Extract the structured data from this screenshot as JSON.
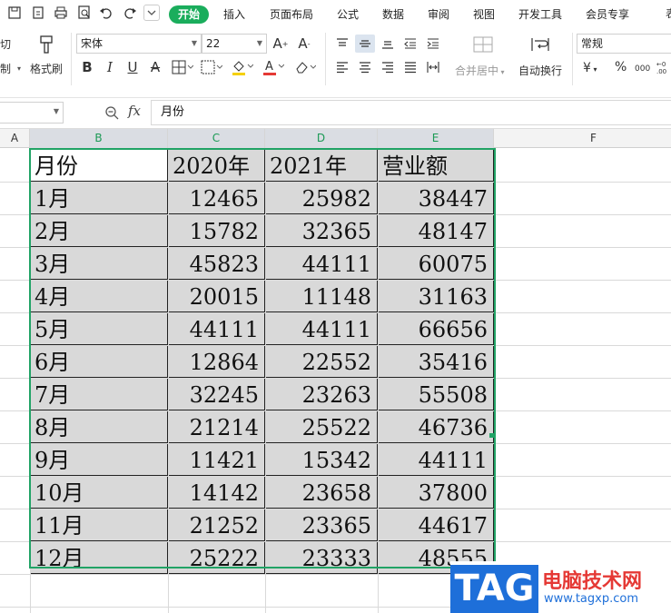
{
  "colors": {
    "accent": "#1aad5c",
    "selection_border": "#21a366",
    "cell_fill": "#d9d9d9",
    "watermark_red": "#e53935",
    "watermark_blue": "#1e6fd9"
  },
  "ribbon": {
    "tabs": [
      "开始",
      "插入",
      "页面布局",
      "公式",
      "数据",
      "审阅",
      "视图",
      "开发工具",
      "会员专享"
    ],
    "active_tab": "开始",
    "cut_label": "剪切",
    "cut_label_partial": "剪切",
    "copy_label": "复制",
    "format_painter_label": "格式刷",
    "font_name": "宋体",
    "font_size": "22",
    "merge_center_label": "合并居中",
    "wrap_text_label": "自动换行",
    "number_format": "常规",
    "font_style_buttons": [
      "B",
      "I",
      "U",
      "A"
    ],
    "currency_symbol": "¥",
    "percent_symbol": "%"
  },
  "formula_bar": {
    "name_box": "",
    "fx_label": "fx",
    "content": "月份"
  },
  "columns": [
    "A",
    "B",
    "C",
    "D",
    "E",
    "F"
  ],
  "selected_columns": [
    "B",
    "C",
    "D",
    "E"
  ],
  "table": {
    "headers": [
      "月份",
      "2020年",
      "2021年",
      "营业额"
    ],
    "rows": [
      [
        "1月",
        "12465",
        "25982",
        "38447"
      ],
      [
        "2月",
        "15782",
        "32365",
        "48147"
      ],
      [
        "3月",
        "45823",
        "44111",
        "60075"
      ],
      [
        "4月",
        "20015",
        "11148",
        "31163"
      ],
      [
        "5月",
        "44111",
        "44111",
        "66656"
      ],
      [
        "6月",
        "12864",
        "22552",
        "35416"
      ],
      [
        "7月",
        "32245",
        "23263",
        "55508"
      ],
      [
        "8月",
        "21214",
        "25522",
        "46736"
      ],
      [
        "9月",
        "11421",
        "15342",
        "44111"
      ],
      [
        "10月",
        "14142",
        "23658",
        "37800"
      ],
      [
        "11月",
        "21252",
        "23365",
        "44617"
      ],
      [
        "12月",
        "25222",
        "23333",
        "48555"
      ]
    ]
  },
  "watermark": {
    "logo_text": "TAG",
    "site_name": "电脑技术网",
    "url": "www.tagxp.com"
  }
}
